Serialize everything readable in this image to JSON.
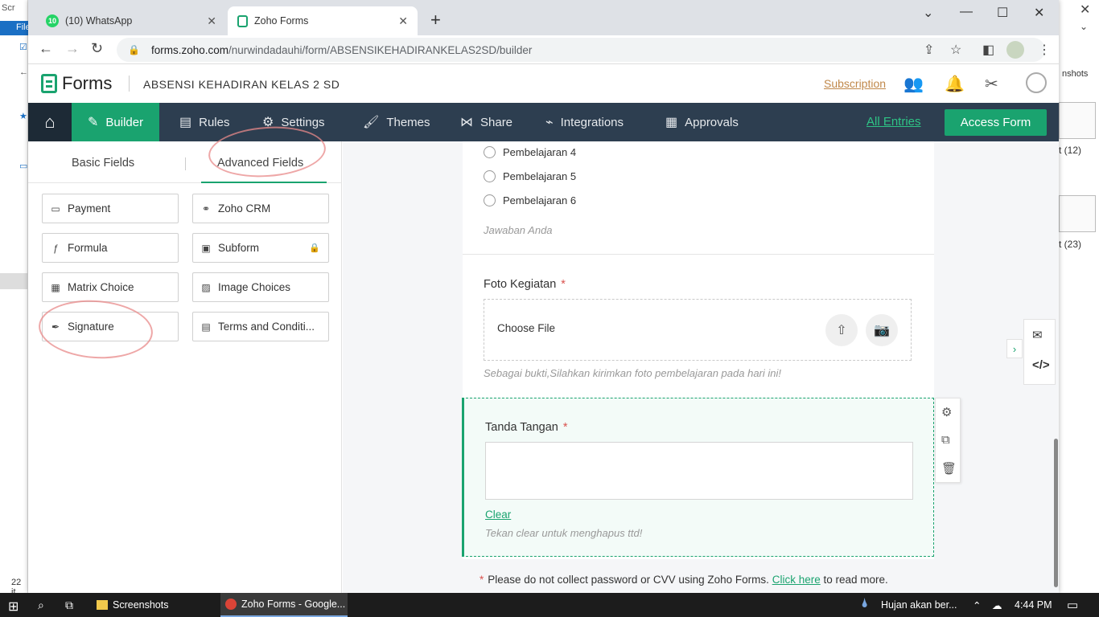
{
  "bg": {
    "explorer_title": "Scr",
    "explorer_file_menu": "File",
    "explorer_item_count": "22 it",
    "right_label_shots": "nshots",
    "right_label_12": "t (12)",
    "right_label_23": "t (23)"
  },
  "browser": {
    "tabs": [
      {
        "title": "(10) WhatsApp",
        "badge": "10"
      },
      {
        "title": "Zoho Forms"
      }
    ],
    "url_host": "forms.zoho.com",
    "url_path": "/nurwindadauhi/form/ABSENSIKEHADIRANKELAS2SD/builder"
  },
  "app": {
    "brand": "Forms",
    "form_name": "ABSENSI KEHADIRAN KELAS 2 SD",
    "subscription": "Subscription"
  },
  "nav": {
    "items": [
      "Builder",
      "Rules",
      "Settings",
      "Themes",
      "Share",
      "Integrations",
      "Approvals"
    ],
    "all_entries": "All Entries",
    "access_form": "Access Form"
  },
  "panel": {
    "tabs": [
      "Basic Fields",
      "Advanced Fields"
    ],
    "fields": [
      "Payment",
      "Zoho CRM",
      "Formula",
      "Subform",
      "Matrix Choice",
      "Image Choices",
      "Signature",
      "Terms and Conditi..."
    ]
  },
  "form": {
    "options": [
      "Pembelajaran 4",
      "Pembelajaran 5",
      "Pembelajaran 6"
    ],
    "options_hint": "Jawaban Anda",
    "photo_label": "Foto Kegiatan",
    "required_mark": "*",
    "choose_file": "Choose File",
    "photo_hint": "Sebagai bukti,Silahkan kirimkan foto pembelajaran pada hari ini!",
    "signature_label": "Tanda Tangan",
    "clear": "Clear",
    "signature_hint": "Tekan clear untuk menghapus ttd!",
    "footer_prefix": "Please do not collect password or CVV using Zoho Forms.",
    "footer_link": "Click here",
    "footer_suffix": "to read more."
  },
  "taskbar": {
    "items": [
      "Screenshots",
      "Zoho Forms - Google..."
    ],
    "weather": "Hujan akan ber...",
    "time": "4:44 PM"
  },
  "colors": {
    "accent": "#1aa36f",
    "nav_bg": "#2d3e50",
    "annotation": "#e88a8a"
  }
}
